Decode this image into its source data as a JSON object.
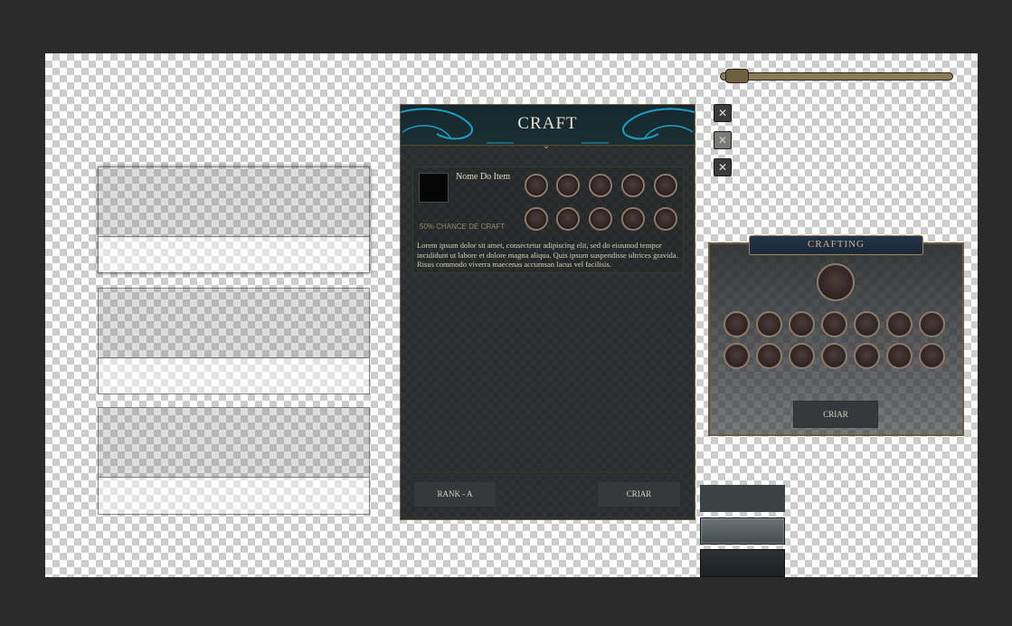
{
  "craft_window": {
    "title": "CRAFT",
    "item_name": "Nome Do Item",
    "chance_label": "50% CHANCE DE CRAFT",
    "description": "Lorem ipsum dolor sit amet, consectetur adipiscing elit, sed do eiusmod tempor incididunt ut labore et dolore magna aliqua. Quis ipsum suspendisse ultrices gravida. Risus commodo viverra maecenas accumsan lacus vel facilisis.",
    "rank_button": "RANK - A",
    "criar_button": "CRIAR"
  },
  "crafting_panel": {
    "title": "CRAFTING",
    "criar_button": "CRIAR"
  },
  "close_icons": [
    "✕",
    "✕",
    "✕"
  ],
  "colors": {
    "workspace_bg": "#2b2b2b",
    "window_bg": "#2a2d2e",
    "gold_border": "#6b5a3c",
    "header_teal": "#1a9fc4",
    "slot_ring": "#8f7a68",
    "button_bg": "#36393b"
  }
}
